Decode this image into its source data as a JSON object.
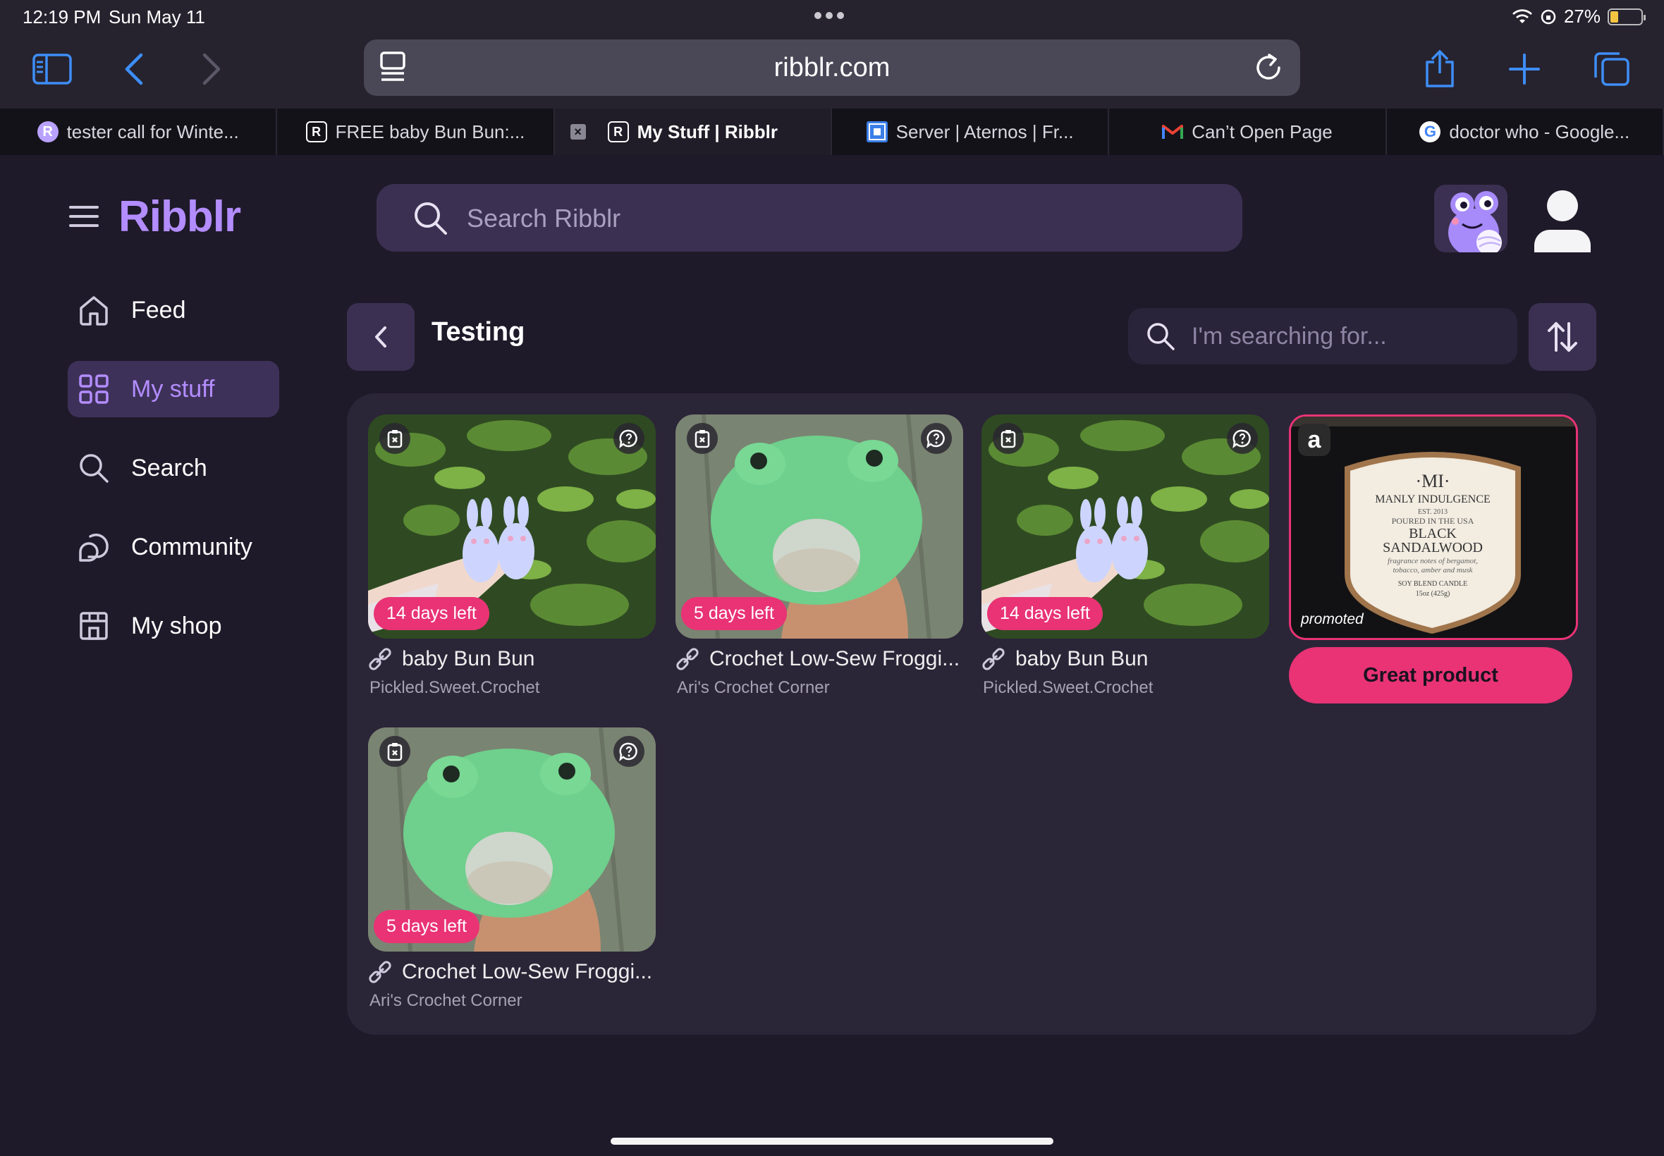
{
  "status_bar": {
    "time": "12:19 PM",
    "date": "Sun May 11",
    "battery": "27%"
  },
  "browser": {
    "url": "ribblr.com",
    "tabs": [
      {
        "label": "tester call for Winte...",
        "favicon": "R",
        "active": false
      },
      {
        "label": "FREE baby Bun Bun:...",
        "favicon": "R",
        "active": false
      },
      {
        "label": "My Stuff | Ribblr",
        "favicon": "R",
        "active": true
      },
      {
        "label": "Server | Aternos | Fr...",
        "favicon": "aternos-icon",
        "active": false
      },
      {
        "label": "Can’t Open Page",
        "favicon": "M",
        "active": false
      },
      {
        "label": "doctor who - Google...",
        "favicon": "G",
        "active": false
      }
    ]
  },
  "app": {
    "logo": "Ribblr",
    "search_placeholder": "Search Ribblr",
    "accent": "#b38dff",
    "pink": "#e93375"
  },
  "nav": [
    {
      "label": "Feed",
      "icon": "home-icon",
      "active": false
    },
    {
      "label": "My stuff",
      "icon": "grid-icon",
      "active": true
    },
    {
      "label": "Search",
      "icon": "search-icon",
      "active": false
    },
    {
      "label": "Community",
      "icon": "chat-icon",
      "active": false
    },
    {
      "label": "My shop",
      "icon": "shop-icon",
      "active": false
    }
  ],
  "folder": {
    "title": "Testing",
    "filter_placeholder": "I'm searching for..."
  },
  "items": [
    {
      "title": "baby Bun Bun",
      "shop": "Pickled.Sweet.Crochet",
      "days_left": "14 days left",
      "image": "bunnies"
    },
    {
      "title": "Crochet Low-Sew Froggi...",
      "shop": "Ari's Crochet Corner",
      "days_left": "5 days left",
      "image": "frog"
    },
    {
      "title": "baby Bun Bun",
      "shop": "Pickled.Sweet.Crochet",
      "days_left": "14 days left",
      "image": "bunnies"
    },
    {
      "title": "Crochet Low-Sew Froggi...",
      "shop": "Ari's Crochet Corner",
      "days_left": "5 days left",
      "image": "frog"
    }
  ],
  "promo": {
    "badge": "a",
    "label": "promoted",
    "button": "Great product",
    "candle": {
      "brand_short": "·MI·",
      "brand": "MANLY INDULGENCE",
      "est": "EST. 2013",
      "origin": "POURED IN THE USA",
      "name_1": "BLACK",
      "name_2": "SANDALWOOD",
      "notes_1": "fragrance notes of bergamot,",
      "notes_2": "tobacco, amber and musk",
      "type": "SOY BLEND CANDLE",
      "weight": "15oz (425g)"
    }
  }
}
